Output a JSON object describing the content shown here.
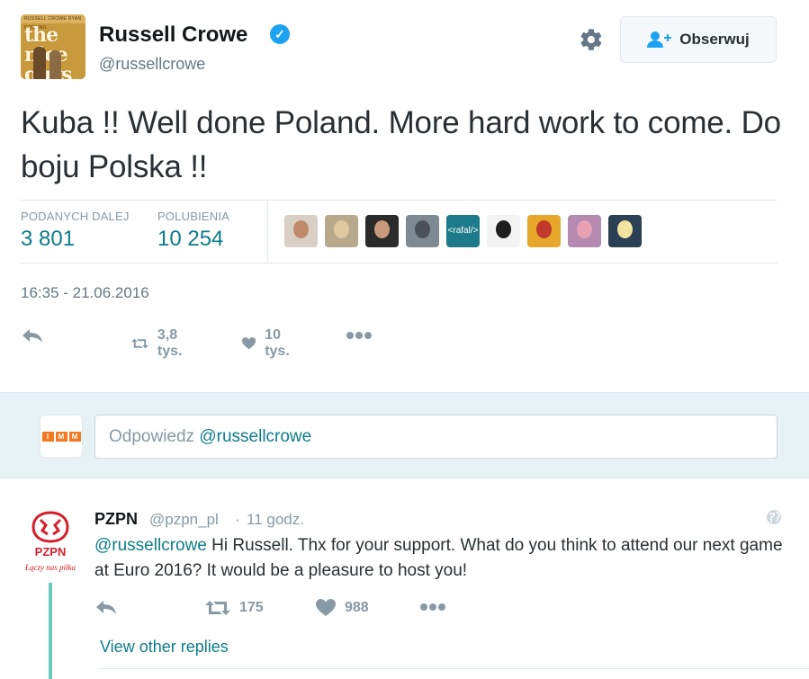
{
  "author": {
    "name": "Russell Crowe",
    "handle": "@russellcrowe",
    "avatar_poster_top": "RUSSELL CROWE   RYAN GOSLING",
    "avatar_poster_title": "the nice guys"
  },
  "header": {
    "follow_label": "Obserwuj"
  },
  "tweet": {
    "text": "Kuba !! Well done Poland. More hard work to come. Do boju Polska !!",
    "timestamp": "16:35 - 21.06.2016"
  },
  "stats": {
    "retweets_label": "PODANYCH DALEJ",
    "retweets_value": "3 801",
    "likes_label": "POLUBIENIA",
    "likes_value": "10 254",
    "likers": [
      {
        "bg": "#d9cfc4",
        "face": "#c08a6a"
      },
      {
        "bg": "#b9a98c",
        "face": "#e0c8a0"
      },
      {
        "bg": "#2b2b2b",
        "face": "#c69a7a"
      },
      {
        "bg": "#7d8a94",
        "face": "#4b5159"
      },
      {
        "bg": "#1d7a8a",
        "text": "<rafal/>"
      },
      {
        "bg": "#f3f3f3",
        "face": "#1e1e1e"
      },
      {
        "bg": "#e7a72a",
        "face": "#c0392b"
      },
      {
        "bg": "#b48ab0",
        "face": "#e8a0b5"
      },
      {
        "bg": "#2b3f55",
        "face": "#f2e4a0"
      }
    ]
  },
  "actions": {
    "retweet_count": "3,8 tys.",
    "like_count": "10 tys."
  },
  "reply_box": {
    "placeholder_prefix": "Odpowiedz ",
    "placeholder_mention": "@russellcrowe",
    "avatar_letters": [
      "I",
      "M",
      "M"
    ]
  },
  "reply": {
    "name": "PZPN",
    "handle": "@pzpn_pl",
    "separator": "·",
    "time": "11 godz.",
    "mention": "@russellcrowe",
    "text": " Hi Russell. Thx for your support. What do you think to attend our next game at Euro 2016? It would be a pleasure to host you!",
    "retweet_count": "175",
    "like_count": "988",
    "avatar_label": "PZPN",
    "avatar_slogan": "Łączy nas piłka",
    "view_replies": "View other replies"
  },
  "colors": {
    "accent": "#0d7c89",
    "verified": "#1da1f2",
    "muted": "#8899a6"
  }
}
